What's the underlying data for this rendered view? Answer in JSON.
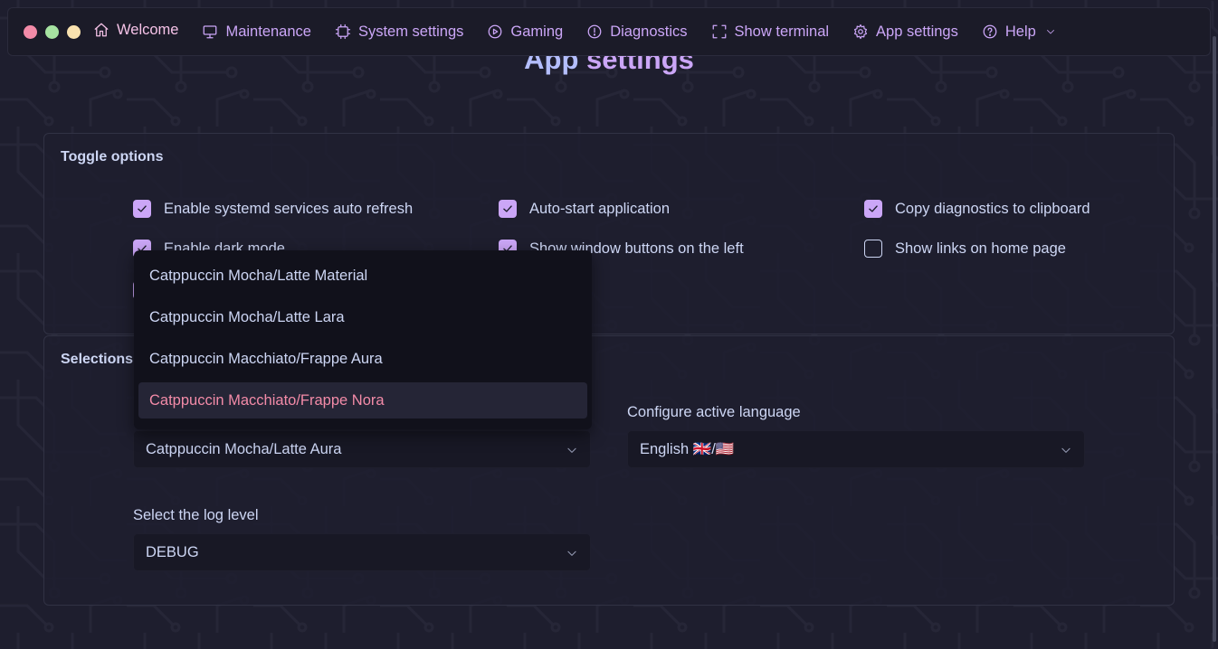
{
  "window": {
    "traffic_lights": [
      "#f38ba8",
      "#a6e3a1",
      "#f9e2af"
    ]
  },
  "nav": {
    "items": [
      {
        "label": "Welcome",
        "icon": "home-icon"
      },
      {
        "label": "Maintenance",
        "icon": "monitor-icon"
      },
      {
        "label": "System settings",
        "icon": "cpu-icon"
      },
      {
        "label": "Gaming",
        "icon": "play-circle-icon"
      },
      {
        "label": "Diagnostics",
        "icon": "info-circle-icon"
      },
      {
        "label": "Show terminal",
        "icon": "fullscreen-icon"
      },
      {
        "label": "App settings",
        "icon": "gear-icon"
      },
      {
        "label": "Help",
        "icon": "help-circle-icon"
      }
    ]
  },
  "page": {
    "title_first": "App",
    "title_rest": "settings"
  },
  "toggle_options": {
    "heading": "Toggle options",
    "checkboxes": [
      {
        "label": "Enable systemd services auto refresh",
        "checked": true
      },
      {
        "label": "Auto-start application",
        "checked": true
      },
      {
        "label": "Copy diagnostics to clipboard",
        "checked": true
      },
      {
        "label": "Enable dark mode",
        "checked": true
      },
      {
        "label": "Show window buttons on the left",
        "checked": true
      },
      {
        "label": "Show links on home page",
        "checked": false
      }
    ]
  },
  "selections": {
    "heading": "Selections",
    "theme_select": {
      "value": "Catppuccin Mocha/Latte Aura"
    },
    "language": {
      "label": "Configure active language",
      "value": "English 🇬🇧/🇺🇸"
    },
    "log_level": {
      "label": "Select the log level",
      "value": "DEBUG"
    }
  },
  "theme_dropdown": {
    "options": [
      "Catppuccin Mocha/Latte Material",
      "Catppuccin Mocha/Latte Lara",
      "Catppuccin Macchiato/Frappe Aura",
      "Catppuccin Macchiato/Frappe Nora"
    ],
    "highlighted_index": 3
  },
  "colors": {
    "accent": "#cba6f7",
    "highlight": "#f38ba8",
    "background": "#1e1e2e",
    "surface": "#181825"
  }
}
